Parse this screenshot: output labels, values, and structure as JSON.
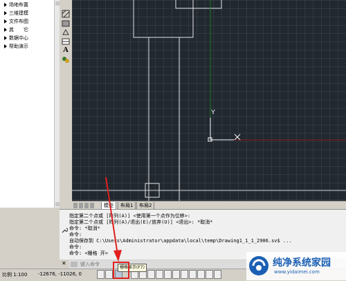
{
  "left_menu": {
    "items": [
      {
        "label": "场地布置"
      },
      {
        "label": "三维建模"
      },
      {
        "label": "文件布图"
      },
      {
        "label": "其　　它"
      },
      {
        "label": "数据中心"
      },
      {
        "label": "帮助演示"
      }
    ]
  },
  "toolbar": {
    "text_tool": "A"
  },
  "canvas": {
    "ucs_y": "Y",
    "ucs_x": "X"
  },
  "tabs": {
    "model": "模型",
    "layout1": "布局1",
    "layout2": "布局2"
  },
  "command_history": [
    "指定第二个点或 [阵列(A)] <使用第一个点作为位移>:",
    "指定第二个点或 [阵列(A)/退出(E)/放弃(U)] <退出>: *取消*",
    "命令: *取消*",
    "命令:",
    "自动保存到 C:\\Users\\Administrator\\appdata\\local\\temp\\Drawing1_1_1_2906.sv$ ...",
    "命令:",
    "命令:  <栅格 开>"
  ],
  "command_input": {
    "placeholder": "键入命令"
  },
  "status": {
    "scale": "比例 1:100",
    "coords": "-12676, -11026, 0",
    "tooltip": "栅格显示(F7)"
  },
  "watermark": {
    "title": "纯净系统家园",
    "url": "www.yidaimei.com"
  },
  "colors": {
    "canvas_bg": "#212830",
    "grid_line": "#303840",
    "annotation_red": "#e0201f",
    "watermark_blue": "#1a5fb4"
  }
}
